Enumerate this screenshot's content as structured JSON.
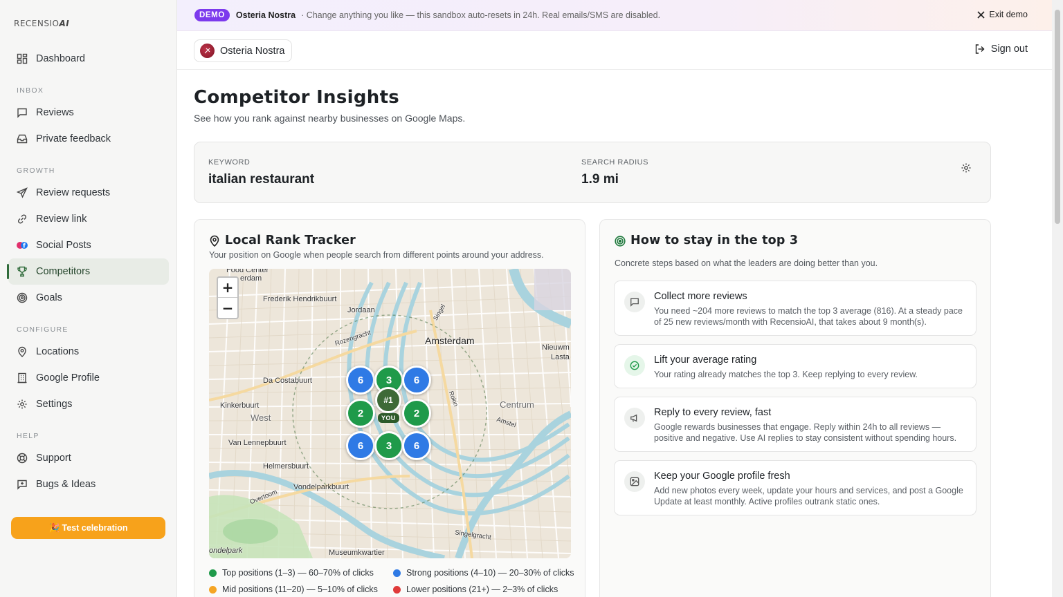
{
  "app": {
    "logo_text": "RECENSIO",
    "logo_suffix": "AI"
  },
  "sidebar": {
    "dashboard": "Dashboard",
    "sections": {
      "inbox": "INBOX",
      "growth": "GROWTH",
      "configure": "CONFIGURE",
      "help": "HELP"
    },
    "items": {
      "reviews": "Reviews",
      "private_feedback": "Private feedback",
      "review_requests": "Review requests",
      "review_link": "Review link",
      "social_posts": "Social Posts",
      "competitors": "Competitors",
      "goals": "Goals",
      "locations": "Locations",
      "google_profile": "Google Profile",
      "settings": "Settings",
      "support": "Support",
      "bugs_ideas": "Bugs & Ideas"
    },
    "active": "competitors",
    "test_button": "🎉 Test celebration"
  },
  "banner": {
    "badge": "DEMO",
    "business": "Osteria Nostra",
    "message": "· Change anything you like — this sandbox auto-resets in 24h. Real emails/SMS are disabled.",
    "exit": "Exit demo"
  },
  "topbar": {
    "business": "Osteria Nostra",
    "sign_out": "Sign out"
  },
  "page": {
    "title": "Competitor Insights",
    "subtitle": "See how you rank against nearby businesses on Google Maps."
  },
  "keyword_card": {
    "keyword_label": "KEYWORD",
    "keyword_value": "italian restaurant",
    "radius_label": "SEARCH RADIUS",
    "radius_value": "1.9 mi"
  },
  "rank_tracker": {
    "title": "Local Rank Tracker",
    "description": "Your position on Google when people search from different points around your address.",
    "zoom_in": "+",
    "zoom_out": "−",
    "you_rank": "#1",
    "you_label": "YOU",
    "grid_ranks": [
      "6",
      "3",
      "6",
      "2",
      "2",
      "6",
      "3",
      "6"
    ],
    "map_labels": {
      "amsterdam": "Amsterdam",
      "frederik": "Frederik Hendrikbuurt",
      "jordaan": "Jordaan",
      "rozengracht": "Rozengracht",
      "da_costa": "Da Costabuurt",
      "kinkerbuurt": "Kinkerbuurt",
      "west": "West",
      "van_lennep": "Van Lennepbuurt",
      "helmersbuurt": "Helmersbuurt",
      "vondelpark": "Vondelparkbuurt",
      "overtoom": "Overtoom",
      "centrum": "Centrum",
      "nieuwm": "Nieuwm",
      "lasta": "Lasta",
      "museumkwartier": "Museumkwartier",
      "ondelpark": "ondelpark",
      "food_center": "Food Center",
      "erdam": "erdam",
      "singelgracht": "Singelgracht",
      "amstel": "Amstel",
      "rokin": "Rokin",
      "singel": "Singel"
    },
    "legend": [
      {
        "label": "Top positions (1–3) — 60–70% of clicks",
        "color": "#1f9a4a"
      },
      {
        "label": "Strong positions (4–10) — 20–30% of clicks",
        "color": "#2f7ae5"
      },
      {
        "label": "Mid positions (11–20) — 5–10% of clicks",
        "color": "#f5a524"
      },
      {
        "label": "Lower positions (21+) — 2–3% of clicks",
        "color": "#e03a3a"
      }
    ]
  },
  "tips": {
    "title": "How to stay in the top 3",
    "description": "Concrete steps based on what the leaders are doing better than you.",
    "items": [
      {
        "title": "Collect more reviews",
        "text": "You need ~204 more reviews to match the top 3 average (816). At a steady pace of 25 new reviews/month with RecensioAI, that takes about 9 month(s)."
      },
      {
        "title": "Lift your average rating",
        "text": "Your rating already matches the top 3. Keep replying to every review."
      },
      {
        "title": "Reply to every review, fast",
        "text": "Google rewards businesses that engage. Reply within 24h to all reviews — positive and negative. Use AI replies to stay consistent without spending hours."
      },
      {
        "title": "Keep your Google profile fresh",
        "text": "Add new photos every week, update your hours and services, and post a Google Update at least monthly. Active profiles outrank static ones."
      }
    ]
  },
  "colors": {
    "accent": "#2f6b3a",
    "demo_badge": "#7c3aed",
    "test_button": "#f7a21b"
  }
}
